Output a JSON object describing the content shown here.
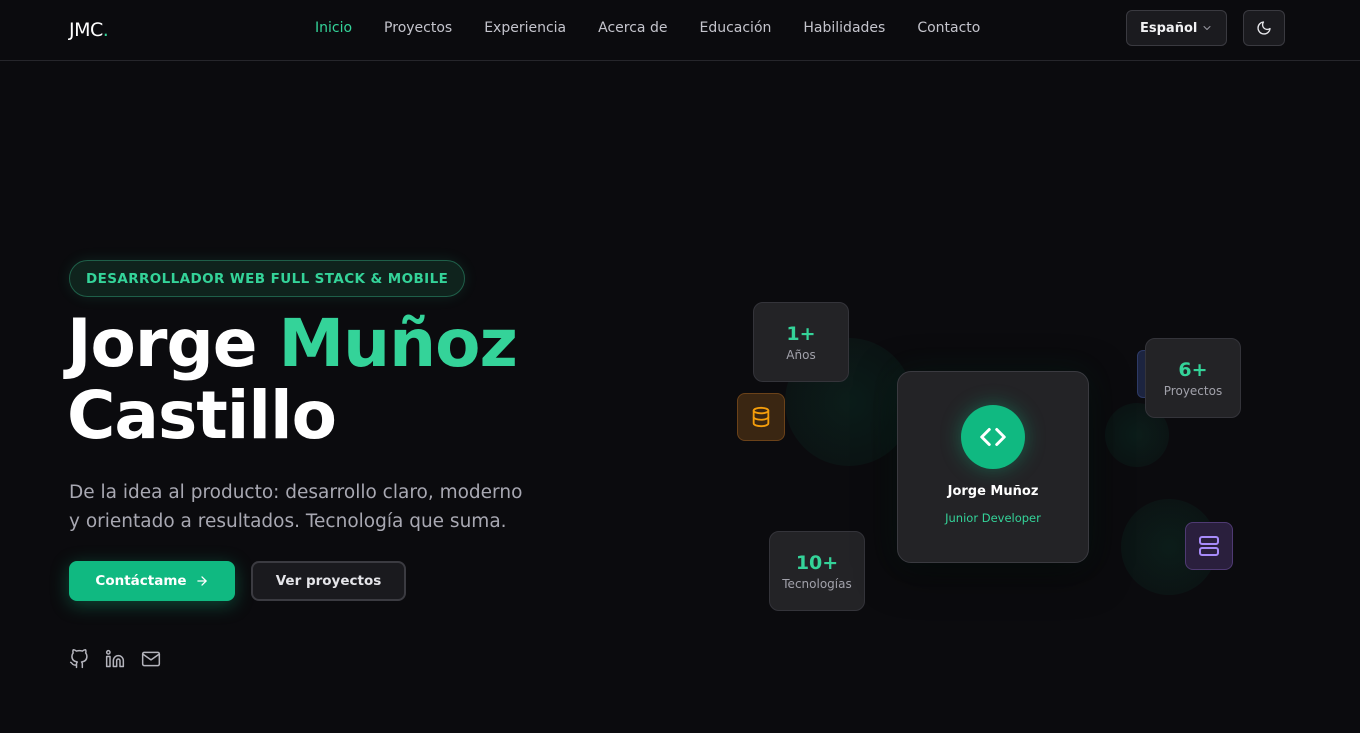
{
  "header": {
    "logo_text": "JMC",
    "logo_dot": ".",
    "nav": [
      {
        "label": "Inicio",
        "active": true
      },
      {
        "label": "Proyectos"
      },
      {
        "label": "Experiencia"
      },
      {
        "label": "Acerca de"
      },
      {
        "label": "Educación"
      },
      {
        "label": "Habilidades"
      },
      {
        "label": "Contacto"
      }
    ],
    "language": "Español",
    "theme_icon": "moon-icon"
  },
  "hero": {
    "badge": "DESARROLLADOR WEB FULL STACK & MOBILE",
    "title_first": "Jorge",
    "title_accent": "Muñoz",
    "title_last": "Castillo",
    "description": "De la idea al producto: desarrollo claro, moderno y orientado a resultados. Tecnología que suma.",
    "primary_button": "Contáctame",
    "secondary_button": "Ver proyectos",
    "socials": [
      "github-icon",
      "linkedin-icon",
      "mail-icon"
    ]
  },
  "profile_card": {
    "name": "Jorge Muñoz",
    "role": "Junior Developer",
    "icon": "code-icon"
  },
  "stats": [
    {
      "value": "1+",
      "label": "Años"
    },
    {
      "value": "6+",
      "label": "Proyectos"
    },
    {
      "value": "10+",
      "label": "Tecnologías"
    }
  ],
  "floating_icons": [
    "database-icon",
    "server-icon"
  ],
  "colors": {
    "accent": "#34d399",
    "primary_button": "#10b981",
    "background": "#0b0b0e"
  }
}
